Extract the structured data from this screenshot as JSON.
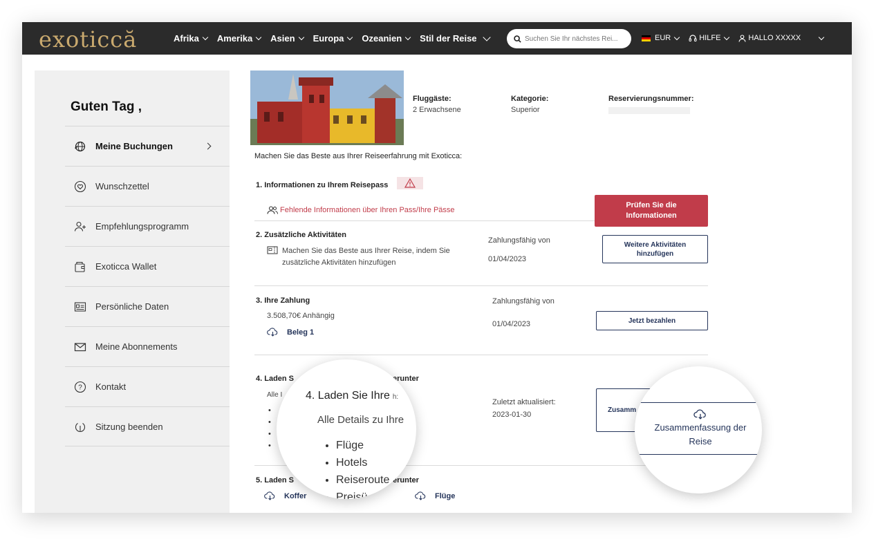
{
  "topbar": {
    "logo": "exoticcă",
    "nav": [
      {
        "label": "Afrika"
      },
      {
        "label": "Amerika"
      },
      {
        "label": "Asien"
      },
      {
        "label": "Europa"
      },
      {
        "label": "Ozeanien"
      },
      {
        "label": "Stil der Reise"
      }
    ],
    "search_placeholder": "Suchen Sie Ihr nächstes Rei...",
    "currency": "EUR",
    "help": "HILFE",
    "user": "HALLO  XXXXX"
  },
  "sidebar": {
    "greeting": "Guten Tag ,",
    "items": [
      {
        "label": "Meine Buchungen",
        "icon": "globe-icon"
      },
      {
        "label": "Wunschzettel",
        "icon": "heart-icon"
      },
      {
        "label": "Empfehlungsprogramm",
        "icon": "add-user-icon"
      },
      {
        "label": "Exoticca Wallet",
        "icon": "wallet-icon"
      },
      {
        "label": "Persönliche Daten",
        "icon": "id-card-icon"
      },
      {
        "label": "Meine Abonnements",
        "icon": "mail-icon"
      },
      {
        "label": "Kontakt",
        "icon": "help-icon"
      },
      {
        "label": "Sitzung beenden",
        "icon": "logout-icon"
      }
    ]
  },
  "booking": {
    "passengers_label": "Fluggäste:",
    "passengers_value": "2 Erwachsene",
    "category_label": "Kategorie:",
    "category_value": "Superior",
    "reservation_label": "Reservierungsnummer:"
  },
  "intro": "Machen Sie das Beste aus Ihrer Reiseerfahrung mit Exoticca:",
  "steps": {
    "s1": {
      "title": "1. Informationen zu Ihrem Reisepass",
      "warning": "Fehlende Informationen über Ihren Pass/Ihre Pässe",
      "button": "Prüfen Sie die Informationen"
    },
    "s2": {
      "title": "2. Zusätzliche Aktivitäten",
      "desc": "Machen Sie das Beste aus Ihrer Reise, indem Sie zusätzliche Aktivitäten hinzufügen",
      "pay_label": "Zahlungsfähig von",
      "pay_date": "01/04/2023",
      "button": "Weitere Aktivitäten hinzufügen"
    },
    "s3": {
      "title": "3. Ihre Zahlung",
      "amount": "3.508,70€ Anhängig",
      "receipt": "Beleg 1",
      "pay_label": "Zahlungsfähig von",
      "pay_date": "01/04/2023",
      "button": "Jetzt bezahlen"
    },
    "s4": {
      "title_left": "4. Laden S",
      "title_right": "erunter",
      "sub_left": "Alle I",
      "updated_label": "Zuletzt aktualisiert:",
      "updated_date": "2023-01-30",
      "button_partial": "Zusamm"
    },
    "s5": {
      "title_left": "5. Laden S",
      "title_right": "erunter",
      "link1": "Koffer",
      "link2": "Flüge"
    }
  },
  "magnifier_left": {
    "title": "4. Laden Sie Ihre",
    "title_tail": "h:",
    "subtitle": "Alle Details zu Ihre",
    "items": [
      "Flüge",
      "Hotels",
      "Reiseroute",
      "Preisü"
    ]
  },
  "magnifier_right": {
    "button": "Zusammenfassung der Reise"
  }
}
